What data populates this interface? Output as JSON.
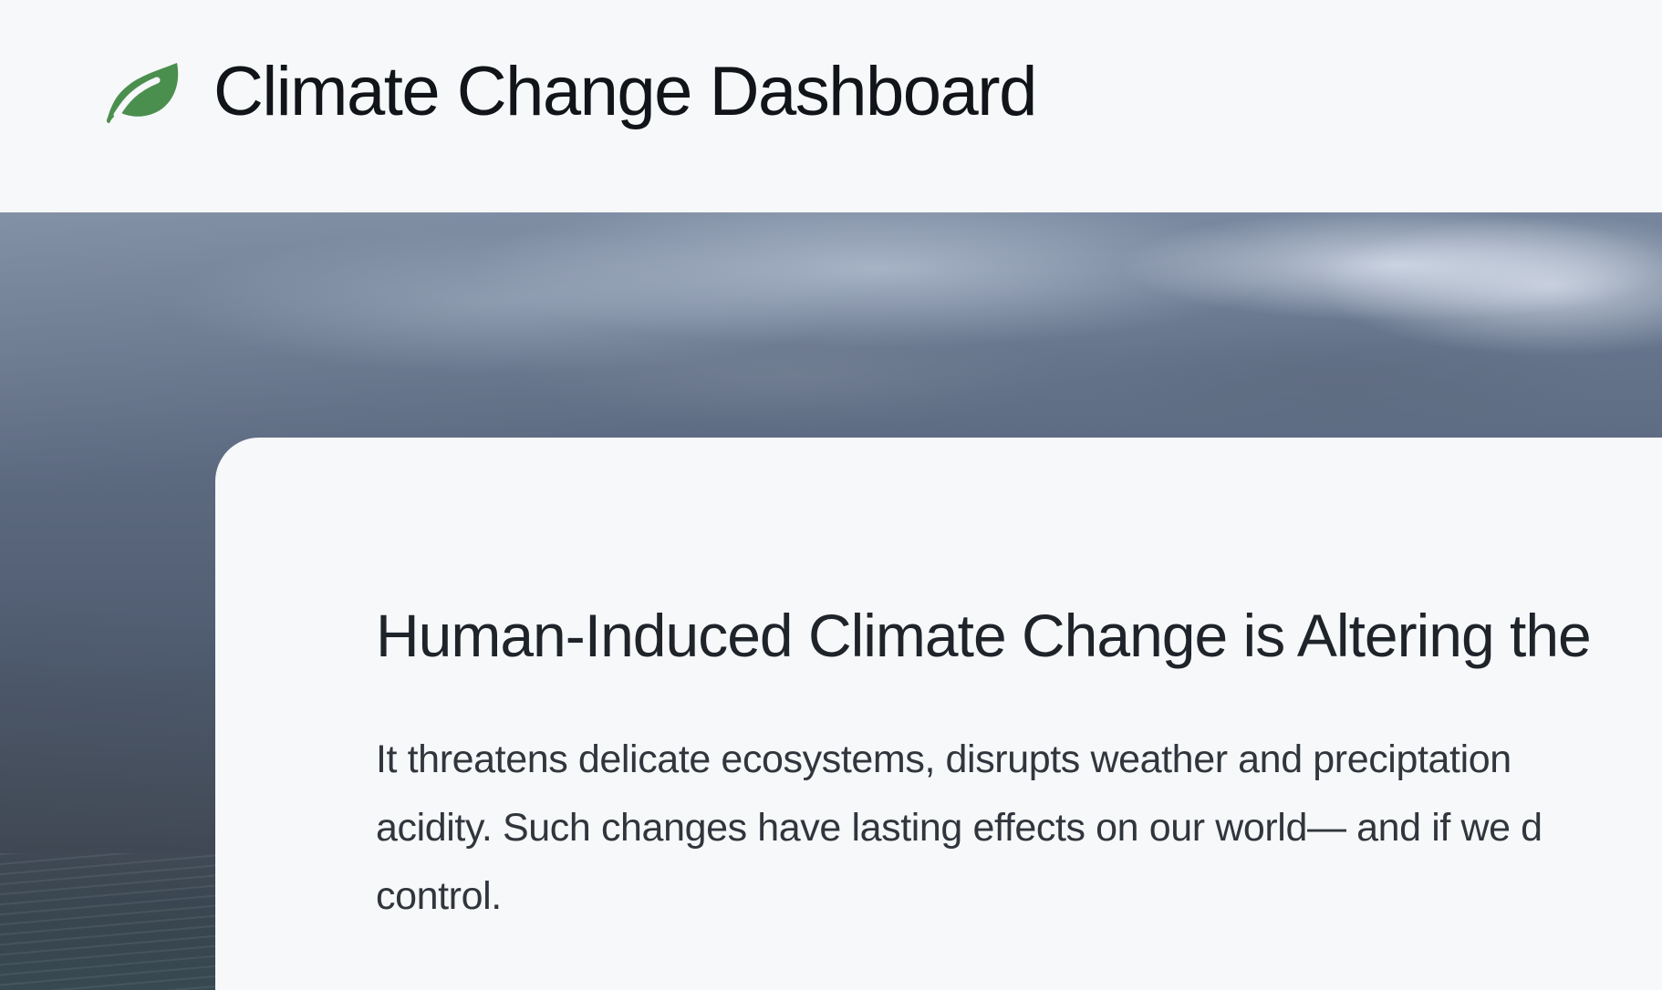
{
  "header": {
    "icon": "leaf-icon",
    "title": "Climate Change Dashboard",
    "icon_color": "#4b8f4f"
  },
  "hero": {
    "background": "stormy-sky-over-sea"
  },
  "content": {
    "headline": "Human-Induced Climate Change is Altering the",
    "body_lines": [
      "It threatens delicate ecosystems, disrupts weather and preciptation",
      "acidity. Such changes have lasting effects on our world— and if we d",
      "control."
    ]
  }
}
